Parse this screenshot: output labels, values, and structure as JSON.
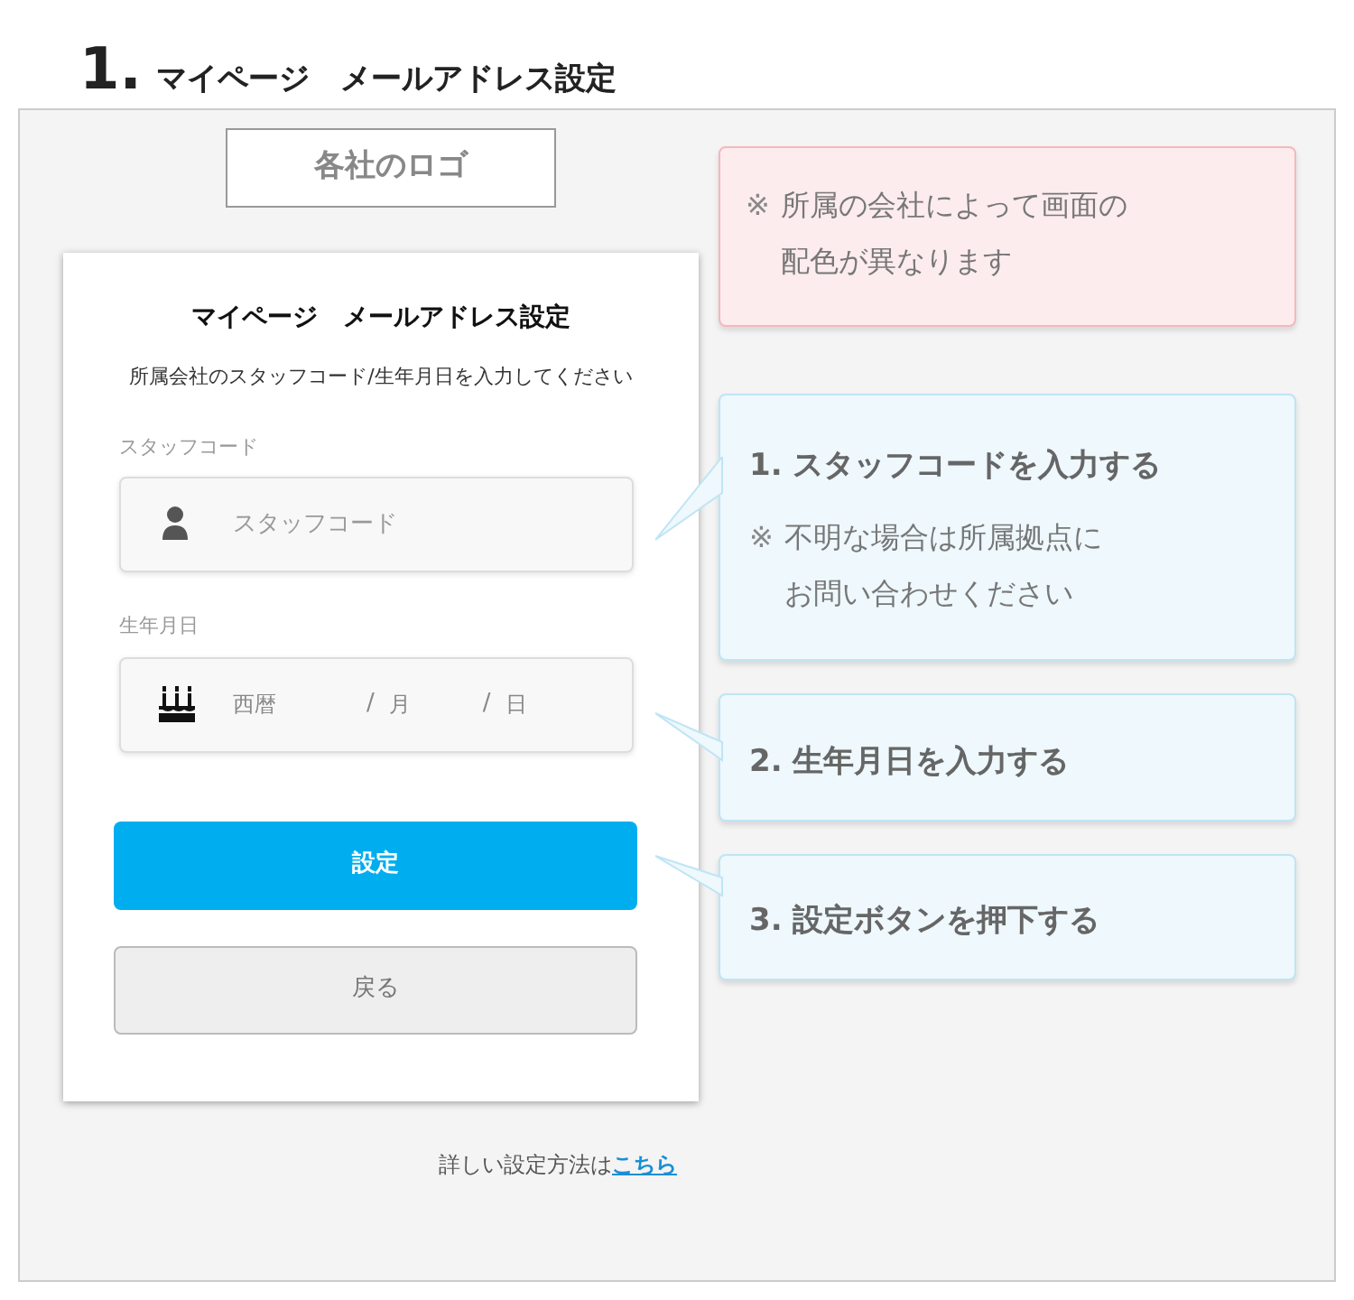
{
  "heading": {
    "number": "1.",
    "title": "マイページ　メールアドレス設定"
  },
  "logo_placeholder": "各社のロゴ",
  "form": {
    "title": "マイページ　メールアドレス設定",
    "instruction": "所属会社のスタッフコード/生年月日を入力してください",
    "fields": [
      {
        "kind": "text",
        "label": "スタッフコード",
        "placeholder": "スタッフコード"
      },
      {
        "kind": "date",
        "label": "生年月日",
        "parts": [
          {
            "placeholder": "西暦"
          },
          {
            "separator": "/",
            "placeholder": "月"
          },
          {
            "separator": "/",
            "placeholder": "日"
          }
        ]
      }
    ],
    "buttons": [
      {
        "kind": "primary",
        "label": "設定"
      },
      {
        "kind": "secondary",
        "label": "戻る"
      }
    ]
  },
  "help": {
    "text": "詳しい設定方法は",
    "link": "こちら"
  },
  "notes": [
    {
      "kind": "warning",
      "mark": "※",
      "lines": [
        "所属の会社によって画面の",
        "配色が異なります"
      ]
    },
    {
      "kind": "step",
      "number": "1.",
      "title": "スタッフコードを入力する",
      "mark": "※",
      "lines": [
        "不明な場合は所属拠点に",
        "お問い合わせください"
      ]
    },
    {
      "kind": "step",
      "number": "2.",
      "title": "生年月日を入力する"
    },
    {
      "kind": "step",
      "number": "3.",
      "title": "設定ボタンを押下する"
    }
  ]
}
